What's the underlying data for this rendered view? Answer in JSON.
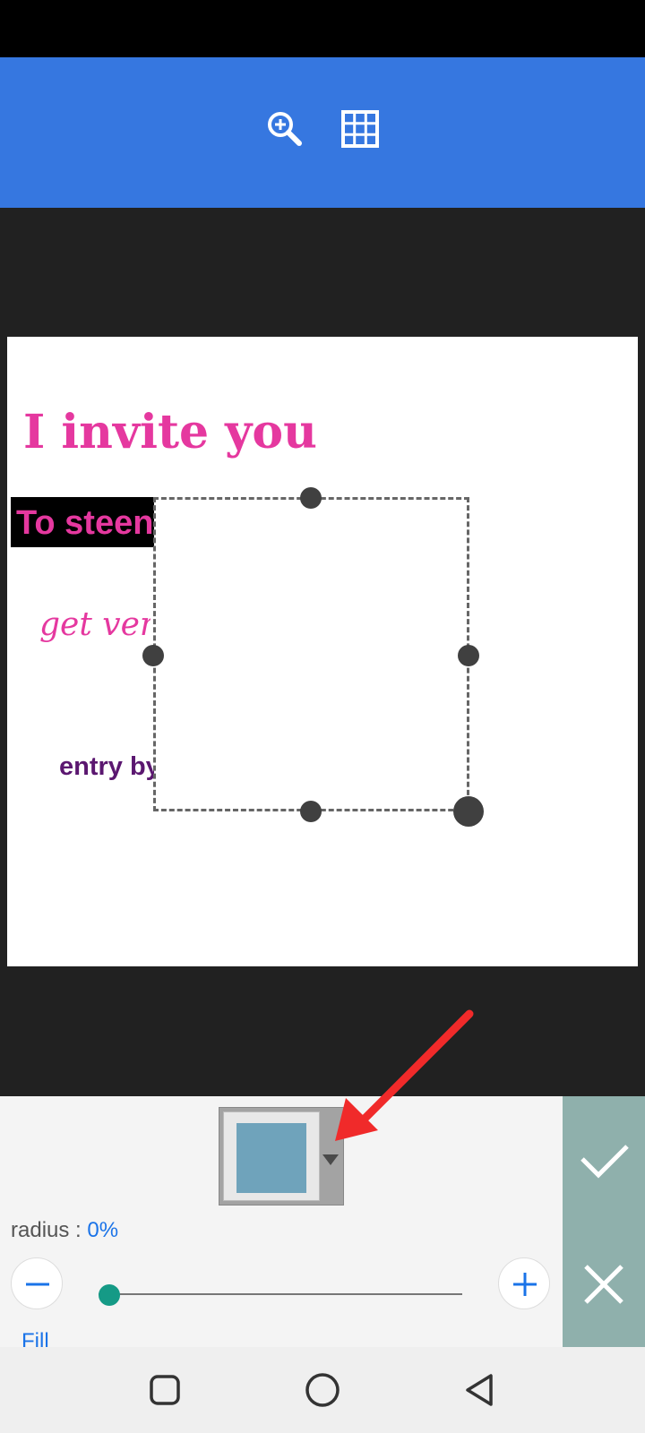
{
  "toolbar": {
    "icons": [
      "zoom-in-icon",
      "grid-icon"
    ],
    "color": "#3677e0"
  },
  "canvas_text": {
    "line1": "I invite you",
    "line2": "To steen",
    "line3": "get veri",
    "line4": "entry by"
  },
  "shape_panel": {
    "fill_color": "#6fa3bb",
    "radius_label": "radius : ",
    "radius_value": "0%",
    "radius_fraction": 0,
    "fill_label": "Fill",
    "confirm_icon": "checkmark-icon",
    "cancel_icon": "close-icon",
    "panel_accent": "#8fb0ac",
    "slider_accent": "#159a86"
  },
  "navbar": {
    "icons": [
      "recent-apps-icon",
      "home-icon",
      "back-icon"
    ]
  },
  "annotation": {
    "arrow_color": "#f02a2a"
  }
}
